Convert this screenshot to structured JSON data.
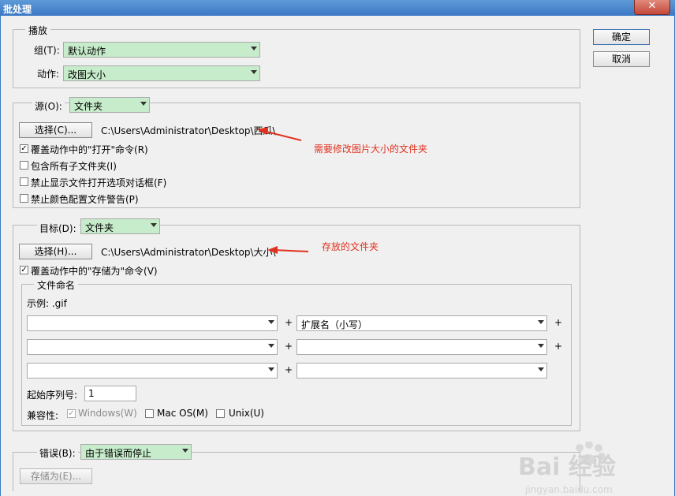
{
  "window": {
    "title": "批处理",
    "close_glyph": "✕"
  },
  "buttons": {
    "ok": "确定",
    "cancel": "取消"
  },
  "play": {
    "legend": "播放",
    "group_label": "组(T):",
    "group_value": "默认动作",
    "action_label": "动作:",
    "action_value": "改图大小"
  },
  "source": {
    "label": "源(O):",
    "value": "文件夹",
    "choose_button": "选择(C)...",
    "path": "C:\\Users\\Administrator\\Desktop\\西瓜\\",
    "annotation": "需要修改图片大小的文件夹",
    "checkboxes": [
      {
        "label": "覆盖动作中的\"打开\"命令(R)",
        "checked": true
      },
      {
        "label": "包含所有子文件夹(I)",
        "checked": false
      },
      {
        "label": "禁止显示文件打开选项对话框(F)",
        "checked": false
      },
      {
        "label": "禁止颜色配置文件警告(P)",
        "checked": false
      }
    ]
  },
  "target": {
    "label": "目标(D):",
    "value": "文件夹",
    "choose_button": "选择(H)...",
    "path": "C:\\Users\\Administrator\\Desktop\\大小\\",
    "annotation": "存放的文件夹",
    "override_save": {
      "label": "覆盖动作中的\"存储为\"命令(V)",
      "checked": true
    }
  },
  "naming": {
    "legend": "文件命名",
    "example": "示例: .gif",
    "rows": [
      {
        "left": "",
        "right": "扩展名（小写）"
      },
      {
        "left": "",
        "right": ""
      },
      {
        "left": "",
        "right": ""
      }
    ],
    "plus": "+",
    "start_serial_label": "起始序列号:",
    "start_serial_value": "1",
    "compat_label": "兼容性:",
    "compat": [
      {
        "label": "Windows(W)",
        "checked": true,
        "disabled": true
      },
      {
        "label": "Mac OS(M)",
        "checked": false,
        "disabled": false
      },
      {
        "label": "Unix(U)",
        "checked": false,
        "disabled": false
      }
    ]
  },
  "errors": {
    "label": "错误(B):",
    "value": "由于错误而停止",
    "save_as_button": "存储为(E)..."
  },
  "watermark": {
    "logo_text": "Bai 经验",
    "sub": "jingyan.baidu.com"
  },
  "colors": {
    "accent_green": "#c7eccb",
    "annotation_red": "#e0321f",
    "titlebar_blue": "#3b78c4"
  },
  "check_glyph": "✓"
}
